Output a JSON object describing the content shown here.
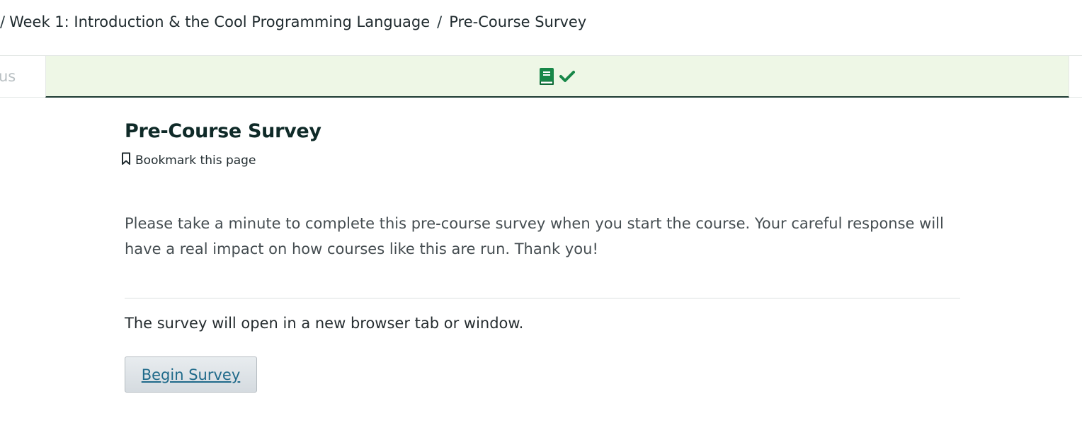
{
  "breadcrumb": {
    "separator": "/",
    "section": "Week 1: Introduction & the Cool Programming Language",
    "current": "Pre-Course Survey"
  },
  "sequence_nav": {
    "prev_tab_fragment": "us",
    "active_tab_icons": [
      "book-icon",
      "checkmark-icon"
    ],
    "active_tab_bg": "#eef7e6",
    "icon_color": "#178748"
  },
  "main": {
    "title": "Pre-Course Survey",
    "bookmark_label": "Bookmark this page",
    "intro_text": "Please take a minute to complete this pre-course survey when you start the course. Your careful response will have a real impact on how courses like this are run. Thank you!",
    "note_text": "The survey will open in a new browser tab or window.",
    "button_label": "Begin Survey"
  }
}
